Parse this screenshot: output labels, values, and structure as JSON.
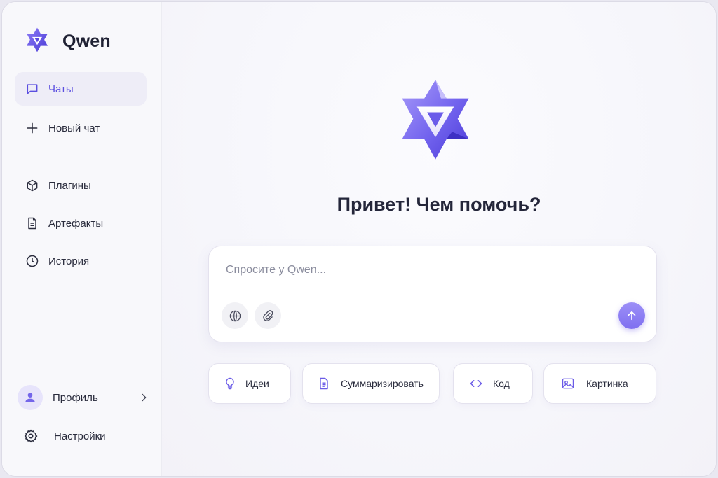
{
  "app": {
    "name": "Qwen"
  },
  "colors": {
    "accent": "#6b5ce7",
    "accent_light": "#9c8ff7",
    "sidebar_bg": "#f8f8fb",
    "active_item_bg": "#eeedf7"
  },
  "sidebar": {
    "items": [
      {
        "label": "Чаты",
        "icon": "chat-bubble-icon",
        "active": true
      },
      {
        "label": "Новый чат",
        "icon": "plus-icon",
        "active": false
      },
      {
        "label": "Плагины",
        "icon": "cube-icon",
        "active": false
      },
      {
        "label": "Артефакты",
        "icon": "document-icon",
        "active": false
      },
      {
        "label": "История",
        "icon": "clock-icon",
        "active": false
      }
    ],
    "profile": {
      "label": "Профиль",
      "icon": "user-icon"
    },
    "settings": {
      "label": "Настройки",
      "icon": "gear-icon"
    }
  },
  "main": {
    "greeting": "Привет! Чем помочь?",
    "composer": {
      "placeholder": "Спросите у Qwen...",
      "tools": [
        "globe-icon",
        "paperclip-icon"
      ],
      "send_icon": "arrow-up-icon"
    },
    "suggestions": [
      {
        "label": "Идеи",
        "icon": "lightbulb-icon"
      },
      {
        "label": "Суммаризировать",
        "icon": "document-icon"
      },
      {
        "label": "Код",
        "icon": "code-icon"
      },
      {
        "label": "Картинка",
        "icon": "image-icon"
      }
    ]
  }
}
